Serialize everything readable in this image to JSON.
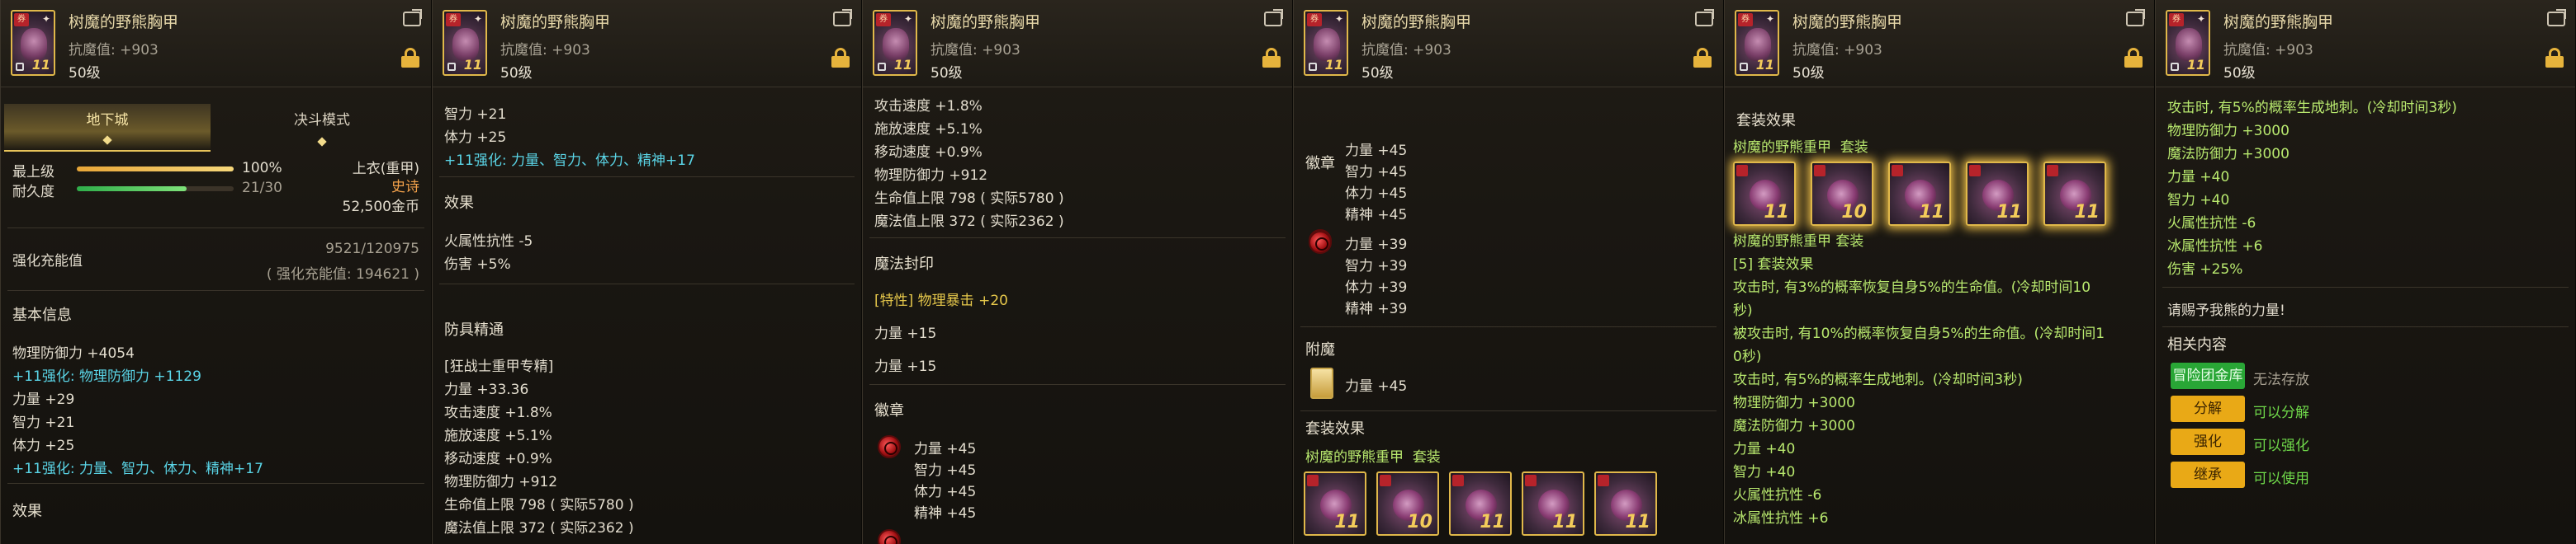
{
  "header": {
    "item_name": "树魔的野熊胸甲",
    "resist": "抗魔值: +903",
    "level": "50级",
    "icon_num": "11"
  },
  "panel1": {
    "tab_dungeon": "地下城",
    "tab_duel": "决斗模式",
    "max_level_label": "最上级",
    "max_level_pct": "100%",
    "durability_label": "耐久度",
    "durability_value": "21/30",
    "max_level_fill": 1.0,
    "durability_fill": 0.7,
    "slot_type": "上衣(重甲)",
    "rarity": "史诗",
    "price": "52,500金币",
    "enhance_label": "强化充能值",
    "enhance_value": "9521/120975",
    "enhance_sub": "( 强化充能值: 194621 )",
    "basic_info": "基本信息",
    "stats": [
      {
        "text": "物理防御力 +4054",
        "color": "white"
      },
      {
        "text": "+11强化: 物理防御力 +1129",
        "color": "cyan"
      },
      {
        "text": "力量 +29",
        "color": "white"
      },
      {
        "text": "智力 +21",
        "color": "white"
      },
      {
        "text": "体力 +25",
        "color": "white"
      },
      {
        "text": "+11强化: 力量、智力、体力、精神+17",
        "color": "cyan"
      }
    ],
    "effect_title": "效果"
  },
  "panel2": {
    "lines_top": [
      {
        "text": "智力 +21",
        "color": "white"
      },
      {
        "text": "体力 +25",
        "color": "white"
      },
      {
        "text": "+11强化: 力量、智力、体力、精神+17",
        "color": "cyan"
      }
    ],
    "effect_title": "效果",
    "effects": [
      "火属性抗性 -5",
      "伤害 +5%"
    ],
    "mastery_title": "防具精通",
    "mastery_tag": "[狂战士重甲专精]",
    "mastery_lines": [
      "力量 +33.36",
      "攻击速度 +1.8%",
      "施放速度 +5.1%",
      "移动速度 +0.9%",
      "物理防御力 +912",
      "生命值上限 798 ( 实际5780 )",
      "魔法值上限 372 ( 实际2362 )"
    ]
  },
  "panel3": {
    "lines_top": [
      "攻击速度 +1.8%",
      "施放速度 +5.1%",
      "移动速度 +0.9%",
      "物理防御力 +912",
      "生命值上限 798 ( 实际5780 )",
      "魔法值上限 372 ( 实际2362 )"
    ],
    "seal_title": "魔法封印",
    "seal_line": "[特性] 物理暴击 +20",
    "seal_stats": [
      "力量 +15",
      "力量 +15"
    ],
    "emblem_title": "徽章",
    "emblem_lines": [
      "力量 +45",
      "智力 +45",
      "体力 +45",
      "精神 +45"
    ]
  },
  "panel4": {
    "emblem_title": "徽章",
    "emblem1": [
      "力量 +45",
      "智力 +45",
      "体力 +45",
      "精神 +45"
    ],
    "emblem2": [
      "力量 +39",
      "智力 +39",
      "体力 +39",
      "精神 +39"
    ],
    "enchant_title": "附魔",
    "enchant_line": "力量 +45",
    "set_title": "套装效果",
    "set_name": "树魔的野熊重甲",
    "set_suffix": "套装",
    "set_nums": [
      "11",
      "10",
      "11",
      "11",
      "11"
    ]
  },
  "panel5": {
    "set_title": "套装效果",
    "set_name": "树魔的野熊重甲",
    "set_suffix": "套装",
    "set_nums": [
      "11",
      "10",
      "11",
      "11",
      "11"
    ],
    "set_caption": "树魔的野熊重甲 套装",
    "set_count": "[5] 套装效果",
    "effect_lines": [
      "攻击时, 有3%的概率恢复自身5%的生命值。(冷却时间10",
      "秒)",
      "被攻击时, 有10%的概率恢复自身5%的生命值。(冷却时间1",
      "0秒)",
      "攻击时, 有5%的概率生成地刺。(冷却时间3秒)",
      "物理防御力 +3000",
      "魔法防御力 +3000",
      "力量 +40",
      "智力 +40",
      "火属性抗性 -6",
      "冰属性抗性 +6"
    ]
  },
  "panel6": {
    "effect_lines": [
      "攻击时, 有5%的概率生成地刺。(冷却时间3秒)",
      "物理防御力 +3000",
      "魔法防御力 +3000",
      "力量 +40",
      "智力 +40",
      "火属性抗性 -6",
      "冰属性抗性 +6",
      "伤害 +25%"
    ],
    "quote": "请赐予我熊的力量!",
    "related_title": "相关内容",
    "buttons": [
      {
        "label": "冒险团金库",
        "desc": "无法存放",
        "style": "green"
      },
      {
        "label": "分解",
        "desc": "可以分解",
        "style": "yellow"
      },
      {
        "label": "强化",
        "desc": "可以强化",
        "style": "yellow"
      },
      {
        "label": "继承",
        "desc": "可以使用",
        "style": "yellow"
      }
    ]
  }
}
